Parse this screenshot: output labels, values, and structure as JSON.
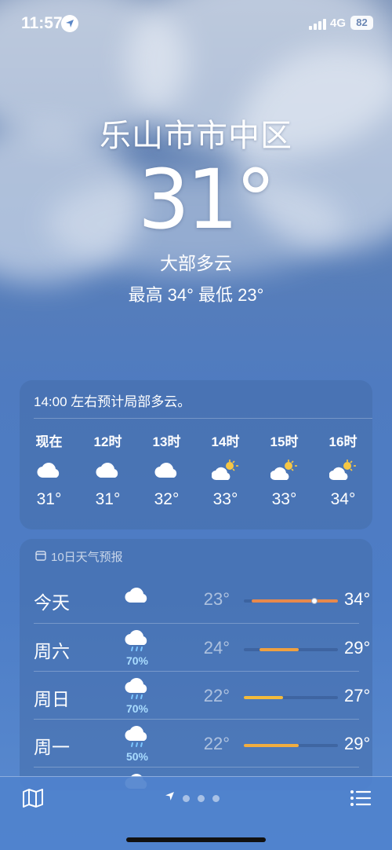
{
  "status_bar": {
    "time": "11:57",
    "network": "4G",
    "battery": "82"
  },
  "hero": {
    "city": "乐山市市中区",
    "temperature": "31°",
    "condition": "大部多云",
    "hi_lo": "最高 34°  最低 23°"
  },
  "hourly": {
    "summary": "14:00 左右预计局部多云。",
    "items": [
      {
        "label": "现在",
        "icon": "cloud-icon",
        "temp": "31°"
      },
      {
        "label": "12时",
        "icon": "cloud-icon",
        "temp": "31°"
      },
      {
        "label": "13时",
        "icon": "cloud-icon",
        "temp": "32°"
      },
      {
        "label": "14时",
        "icon": "sun-behind-cloud-icon",
        "temp": "33°"
      },
      {
        "label": "15时",
        "icon": "sun-behind-cloud-icon",
        "temp": "33°"
      },
      {
        "label": "16时",
        "icon": "sun-behind-cloud-icon",
        "temp": "34°"
      }
    ]
  },
  "daily": {
    "header": "10日天气预报",
    "range_min": 22,
    "range_max": 34,
    "days": [
      {
        "name": "今天",
        "icon": "cloud-icon",
        "precip": "",
        "low": "23°",
        "high": "34°",
        "low_val": 23,
        "high_val": 34,
        "current_val": 31,
        "bar_color": "#e8894b"
      },
      {
        "name": "周六",
        "icon": "cloud-rain-icon",
        "precip": "70%",
        "low": "24°",
        "high": "29°",
        "low_val": 24,
        "high_val": 29,
        "bar_color": "#efa040"
      },
      {
        "name": "周日",
        "icon": "cloud-rain-icon",
        "precip": "70%",
        "low": "22°",
        "high": "27°",
        "low_val": 22,
        "high_val": 27,
        "bar_color": "#f3bb3c"
      },
      {
        "name": "周一",
        "icon": "cloud-rain-icon",
        "precip": "50%",
        "low": "22°",
        "high": "29°",
        "low_val": 22,
        "high_val": 29,
        "bar_color": "#f1ad40"
      }
    ]
  },
  "colors": {
    "accent_precip": "#a9dcff",
    "tabbar": "#4f82cd"
  }
}
